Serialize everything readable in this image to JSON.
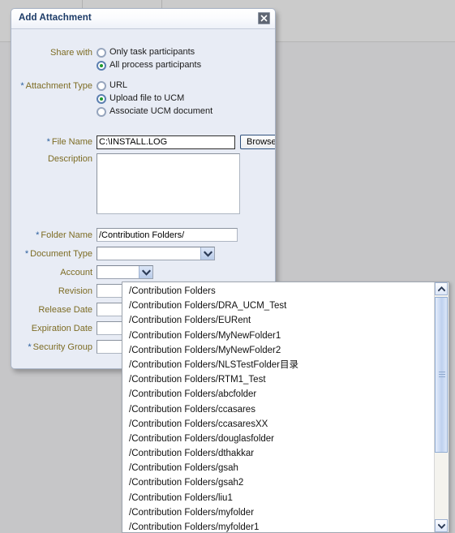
{
  "dialog": {
    "title": "Add Attachment",
    "close_label": "Close",
    "share_with": {
      "label": "Share with",
      "options": [
        {
          "label": "Only task participants",
          "selected": false
        },
        {
          "label": "All process participants",
          "selected": true
        }
      ]
    },
    "attachment_type": {
      "label": "Attachment Type",
      "required": true,
      "options": [
        {
          "label": "URL",
          "selected": false
        },
        {
          "label": "Upload file to UCM",
          "selected": true
        },
        {
          "label": "Associate UCM document",
          "selected": false
        }
      ]
    },
    "file_name": {
      "label": "File Name",
      "required": true,
      "value": "C:\\INSTALL.LOG",
      "placeholder": ""
    },
    "browse_button": "Browse...",
    "description": {
      "label": "Description",
      "required": false,
      "value": "",
      "placeholder": ""
    },
    "folder_name": {
      "label": "Folder Name",
      "required": true,
      "value": "/Contribution Folders/",
      "placeholder": ""
    },
    "document_type": {
      "label": "Document Type",
      "required": true,
      "value": ""
    },
    "account": {
      "label": "Account",
      "required": false,
      "value": ""
    },
    "revision": {
      "label": "Revision",
      "required": false,
      "value": "",
      "placeholder": ""
    },
    "release_date": {
      "label": "Release Date",
      "required": false,
      "value": "",
      "placeholder": ""
    },
    "expiration_date": {
      "label": "Expiration Date",
      "required": false,
      "value": "",
      "placeholder": ""
    },
    "security_group": {
      "label": "Security Group",
      "required": true,
      "value": "",
      "placeholder": ""
    }
  },
  "folder_dropdown": {
    "items": [
      "/Contribution Folders",
      "/Contribution Folders/DRA_UCM_Test",
      "/Contribution Folders/EURent",
      "/Contribution Folders/MyNewFolder1",
      "/Contribution Folders/MyNewFolder2",
      "/Contribution Folders/NLSTestFolder目录",
      "/Contribution Folders/RTM1_Test",
      "/Contribution Folders/abcfolder",
      "/Contribution Folders/ccasares",
      "/Contribution Folders/ccasaresXX",
      "/Contribution Folders/douglasfolder",
      "/Contribution Folders/dthakkar",
      "/Contribution Folders/gsah",
      "/Contribution Folders/gsah2",
      "/Contribution Folders/liu1",
      "/Contribution Folders/myfolder",
      "/Contribution Folders/myfolder1"
    ],
    "scroll_up_icon": "chevron-up-icon",
    "scroll_down_icon": "chevron-down-icon"
  },
  "colors": {
    "label": "#7d6c24",
    "required_marker": "#2b5f9e",
    "title": "#1b3a66",
    "radio_selected": "#1f9a2f",
    "dialog_background": "#e8ecf5",
    "page_background": "#c9c9c9"
  }
}
